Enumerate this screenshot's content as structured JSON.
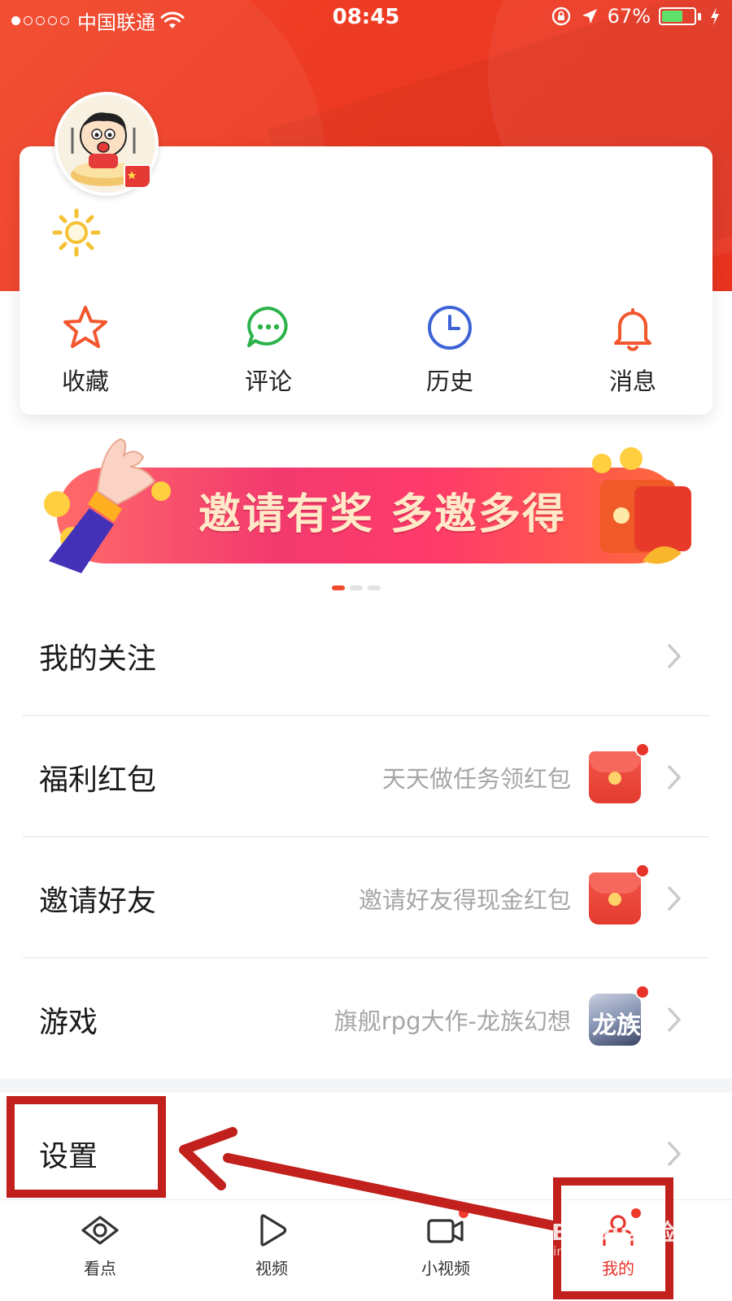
{
  "status_bar": {
    "carrier": "中国联通",
    "time": "08:45",
    "battery": "67%",
    "battery_level": 0.67
  },
  "profile": {
    "avatar_icon": "cartoon-avatar",
    "badge_icon": "flag-badge",
    "level_icon": "sun-icon"
  },
  "quick_actions": [
    {
      "label": "收藏",
      "icon": "star-icon"
    },
    {
      "label": "评论",
      "icon": "comment-icon"
    },
    {
      "label": "历史",
      "icon": "clock-icon"
    },
    {
      "label": "消息",
      "icon": "bell-icon"
    }
  ],
  "banner": {
    "text": "邀请有奖 多邀多得",
    "page_count": 3,
    "active_page": 1
  },
  "menu": [
    {
      "title": "我的关注",
      "subtitle": "",
      "icon": ""
    },
    {
      "title": "福利红包",
      "subtitle": "天天做任务领红包",
      "icon": "red-packet-icon"
    },
    {
      "title": "邀请好友",
      "subtitle": "邀请好友得现金红包",
      "icon": "red-packet-icon"
    },
    {
      "title": "游戏",
      "subtitle": "旗舰rpg大作-龙族幻想",
      "icon": "game-icon",
      "icon_text": "龙族"
    },
    {
      "title": "设置",
      "subtitle": "",
      "icon": ""
    }
  ],
  "tabs": [
    {
      "label": "看点",
      "icon": "eye-icon"
    },
    {
      "label": "视频",
      "icon": "play-icon"
    },
    {
      "label": "小视频",
      "icon": "camera-icon"
    },
    {
      "label": "我的",
      "icon": "profile-icon",
      "active": true
    }
  ],
  "watermark": {
    "brand": "Baidu经验",
    "url": "jingyan.baidu.com"
  },
  "colors": {
    "header_red": "#ee3b23",
    "accent_red": "#e8332a",
    "annotation": "#c1201c"
  }
}
